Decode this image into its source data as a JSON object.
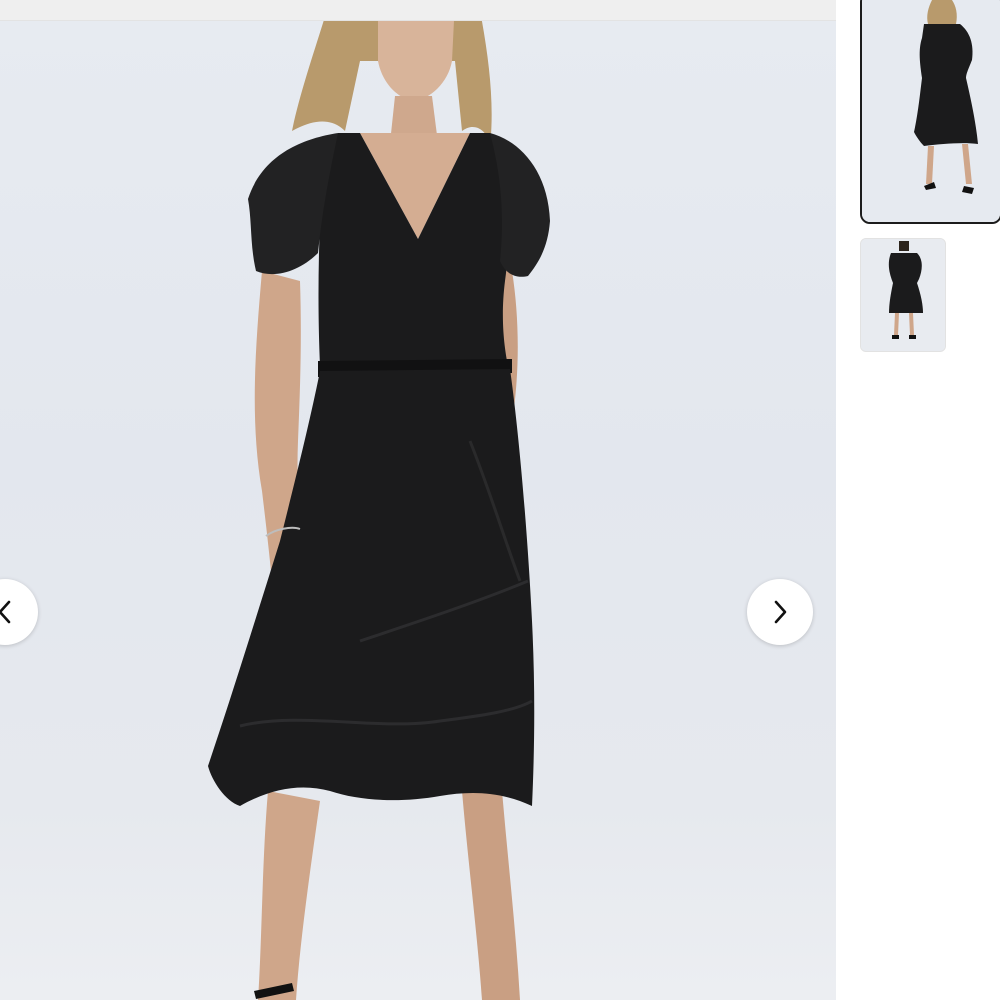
{
  "gallery": {
    "main_image": {
      "icon": "product-photo",
      "subject": "black-wrap-dress"
    },
    "prev_button": {
      "icon": "chevron-left-icon"
    },
    "next_button": {
      "icon": "chevron-right-icon"
    },
    "thumbnails": [
      {
        "icon": "product-photo-front",
        "selected": true
      },
      {
        "icon": "product-photo-back",
        "selected": false
      }
    ]
  },
  "colors": {
    "backdrop": "#e5e9ef",
    "dress": "#1b1b1c",
    "selected_border": "#1c1c1c",
    "button_bg": "#ffffff"
  }
}
